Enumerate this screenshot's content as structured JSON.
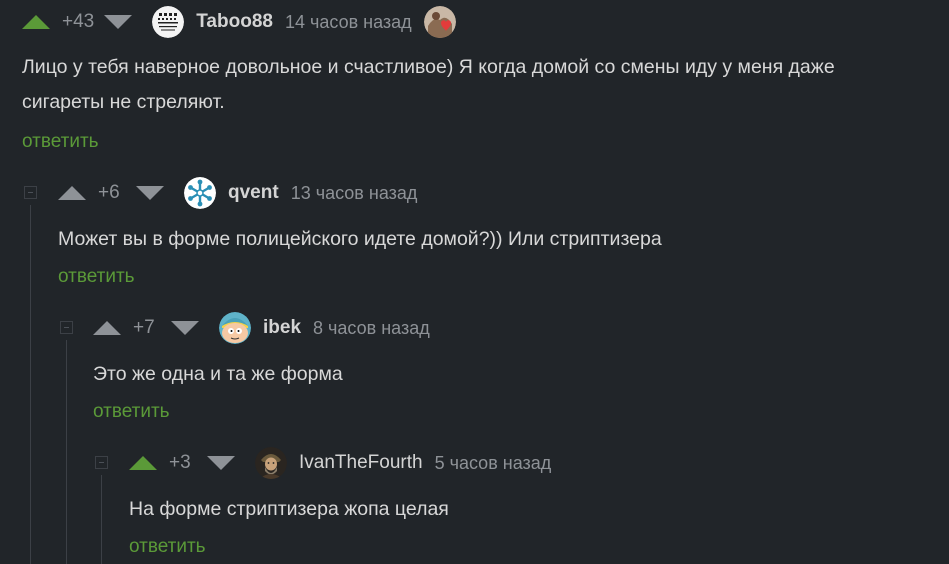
{
  "reply_label": "ответить",
  "colors": {
    "upvote_active": "#5b9a38",
    "vote": "#8e9297",
    "reply": "#5b9a38",
    "background": "#212529"
  },
  "comments": [
    {
      "rating": "+43",
      "author": "Taboo88",
      "time": "14 часов назад",
      "avatar_icon": "eye-chart-avatar-icon",
      "badge_icon": "award-badge-icon",
      "upvoted": true,
      "text_lines": [
        "Лицо у тебя наверное довольное и счастливое) Я когда домой со смены иду у меня даже",
        "сигареты не стреляют."
      ]
    },
    {
      "rating": "+6",
      "author": "qvent",
      "time": "13 часов назад",
      "avatar_icon": "snowflake-avatar-icon",
      "upvoted": false,
      "text_lines": [
        "Может вы в форме полицейского идете домой?)) Или стриптизера"
      ]
    },
    {
      "rating": "+7",
      "author": "ibek",
      "time": "8 часов назад",
      "avatar_icon": "cartman-avatar-icon",
      "upvoted": false,
      "text_lines": [
        "Это же одна и та же форма"
      ]
    },
    {
      "rating": "+3",
      "author": "IvanTheFourth",
      "time": "5 часов назад",
      "avatar_icon": "portrait-avatar-icon",
      "upvoted": true,
      "text_lines": [
        "На форме стриптизера жопа целая"
      ]
    }
  ]
}
